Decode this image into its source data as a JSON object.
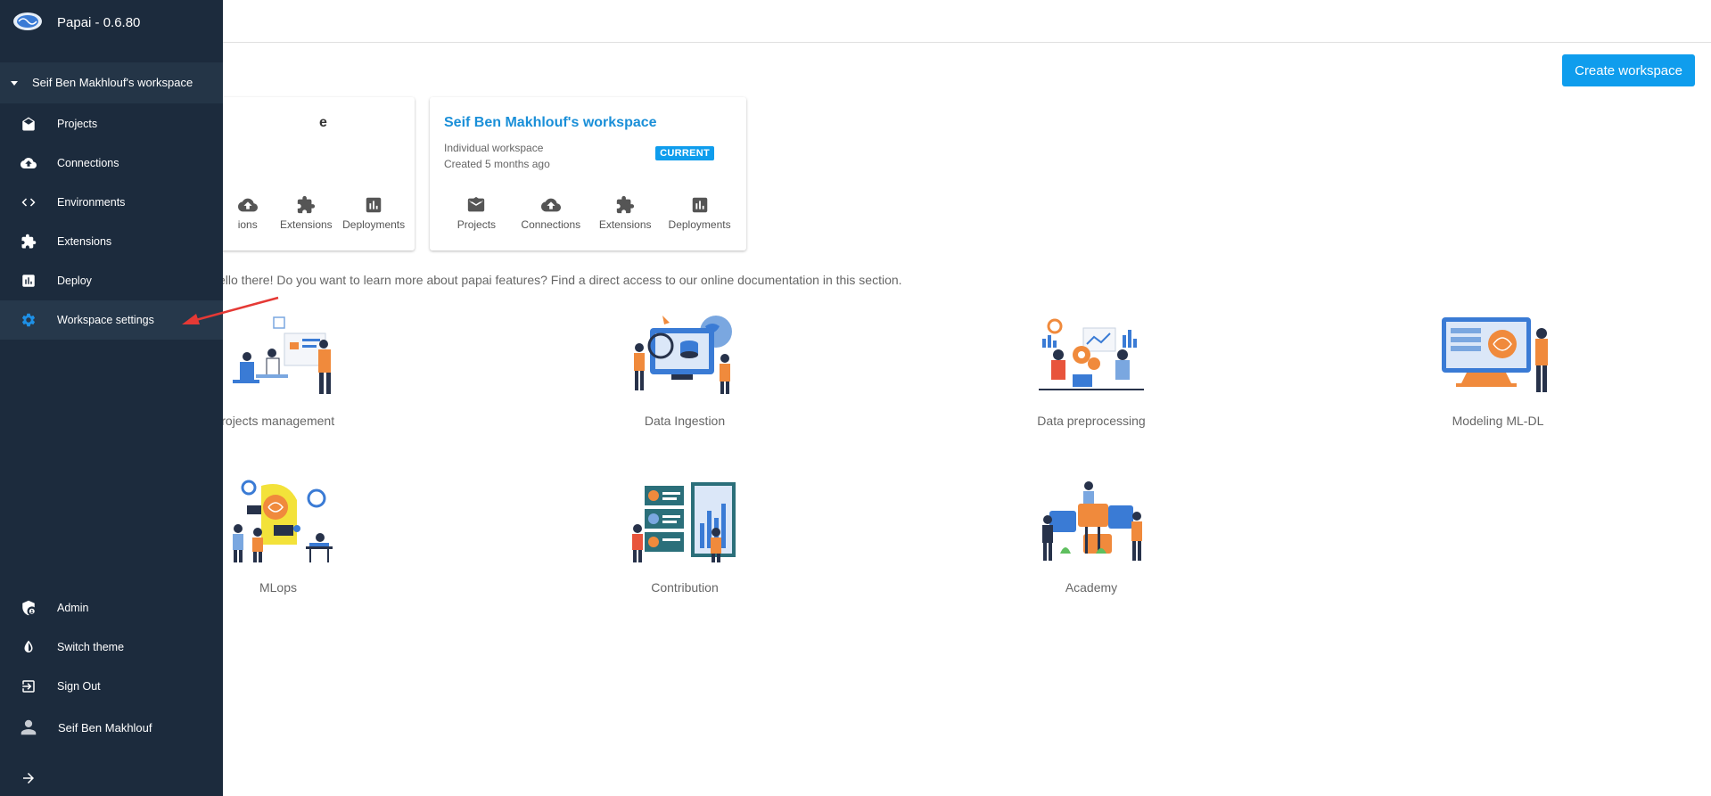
{
  "app": {
    "title": "Papai - 0.6.80"
  },
  "sidebar": {
    "workspace_label": "Seif Ben Makhlouf's workspace",
    "items": [
      {
        "label": "Projects",
        "icon": "inbox-icon"
      },
      {
        "label": "Connections",
        "icon": "cloud-upload-icon"
      },
      {
        "label": "Environments",
        "icon": "code-icon"
      },
      {
        "label": "Extensions",
        "icon": "puzzle-icon"
      },
      {
        "label": "Deploy",
        "icon": "bar-chart-icon"
      },
      {
        "label": "Workspace settings",
        "icon": "gear-icon"
      }
    ],
    "bottom_items": [
      {
        "label": "Admin",
        "icon": "admin-shield-icon"
      },
      {
        "label": "Switch theme",
        "icon": "contrast-icon"
      },
      {
        "label": "Sign Out",
        "icon": "sign-out-icon"
      },
      {
        "label": "Seif Ben Makhlouf",
        "icon": "user-icon"
      }
    ]
  },
  "header": {
    "create_label": "Create workspace"
  },
  "cards": [
    {
      "title": "e",
      "actions": [
        {
          "label": "ions",
          "icon": "cloud-upload-icon"
        },
        {
          "label": "Extensions",
          "icon": "puzzle-icon"
        },
        {
          "label": "Deployments",
          "icon": "bar-chart-icon"
        }
      ]
    },
    {
      "title": "Seif Ben Makhlouf's workspace",
      "subtitle": "Individual workspace",
      "created": "Created 5 months ago",
      "badge": "CURRENT",
      "actions": [
        {
          "label": "Projects",
          "icon": "inbox-icon"
        },
        {
          "label": "Connections",
          "icon": "cloud-upload-icon"
        },
        {
          "label": "Extensions",
          "icon": "puzzle-icon"
        },
        {
          "label": "Deployments",
          "icon": "bar-chart-icon"
        }
      ]
    }
  ],
  "intro_text": "ello there! Do you want to learn more about papai features? Find a direct access to our online documentation in this section.",
  "features": [
    {
      "label": "Projects management"
    },
    {
      "label": "Data Ingestion"
    },
    {
      "label": "Data preprocessing"
    },
    {
      "label": "Modeling ML-DL"
    },
    {
      "label": "MLops"
    },
    {
      "label": "Contribution"
    },
    {
      "label": "Academy"
    }
  ],
  "colors": {
    "sidebar_bg": "#1c2b3d",
    "accent": "#0f9ded",
    "active_icon": "#1e90e6",
    "illustration_orange": "#f08a3c",
    "illustration_blue": "#3a7bd5",
    "annotation_red": "#e53935"
  }
}
